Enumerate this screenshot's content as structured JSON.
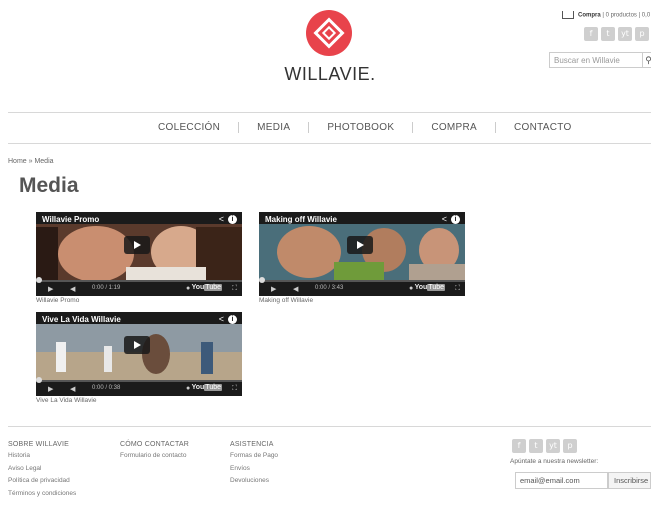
{
  "header": {
    "brand": "WILLAVIE.",
    "cart_label": "Compra",
    "cart_info": " | 0 productos | 0,0",
    "social": [
      "f",
      "t",
      "yt",
      "p"
    ],
    "search_placeholder": "Buscar en Willavie",
    "search_icon": "magnifier-icon"
  },
  "nav": {
    "items": [
      "COLECCIÓN",
      "MEDIA",
      "PHOTOBOOK",
      "COMPRA",
      "CONTACTO"
    ]
  },
  "breadcrumb": "Home » Media",
  "page_title": "Media",
  "videos": [
    {
      "title": "Willavie Promo",
      "time": "0:00 / 1:19",
      "caption": "Willavie Promo"
    },
    {
      "title": "Making off Willavie",
      "time": "0:00 / 3:43",
      "caption": "Making off Willavie"
    },
    {
      "title": "Vive La Vida Willavie",
      "time": "0:00 / 0:38",
      "caption": "Vive La Vida Willavie"
    }
  ],
  "video_labels": {
    "youtube": "You",
    "youtube_tube": "Tube"
  },
  "footer": {
    "col1": {
      "heading": "SOBRE WILLAVIE",
      "links": [
        "Historia",
        "Aviso Legal",
        "Política de privacidad",
        "Términos y condiciones"
      ]
    },
    "col2": {
      "heading": "CÓMO CONTACTAR",
      "links": [
        "Formulario de contacto"
      ]
    },
    "col3": {
      "heading": "ASISTENCIA",
      "links": [
        "Formas de Pago",
        "Envíos",
        "Devoluciones"
      ]
    },
    "newsletter_label": "Apúntate a nuestra newsletter:",
    "email_value": "email@email.com",
    "subscribe_label": "Inscribirse"
  },
  "colors": {
    "brand_red": "#e8434b",
    "text": "#444444",
    "rule": "#d8d8d8"
  }
}
